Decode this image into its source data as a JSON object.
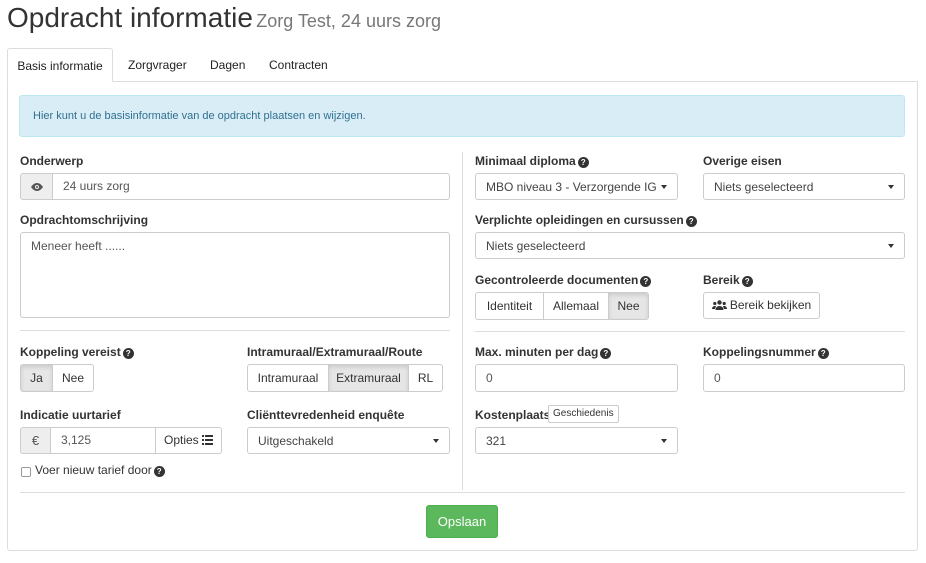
{
  "header": {
    "title": "Opdracht informatie",
    "subtitle": "Zorg Test, 24 uurs zorg"
  },
  "tabs": [
    {
      "label": "Basis informatie",
      "active": true
    },
    {
      "label": "Zorgvrager"
    },
    {
      "label": "Dagen"
    },
    {
      "label": "Contracten"
    }
  ],
  "alert": {
    "text": "Hier kunt u de basisinformatie van de opdracht plaatsen en wijzigen."
  },
  "left": {
    "onderwerp": {
      "label": "Onderwerp",
      "value": "24 uurs zorg",
      "icon": "eye-icon"
    },
    "omschrijving": {
      "label": "Opdrachtomschrijving",
      "value": "Meneer heeft ......"
    },
    "koppeling": {
      "label": "Koppeling vereist",
      "options": [
        "Ja",
        "Nee"
      ],
      "selected": "Ja"
    },
    "intramuraal": {
      "label": "Intramuraal/Extramuraal/Route",
      "options": [
        "Intramuraal",
        "Extramuraal",
        "RL"
      ],
      "selected": "Extramuraal"
    },
    "uurtarief": {
      "label": "Indicatie uurtarief",
      "currency": "€",
      "value": "3,125",
      "options_label": "Opties"
    },
    "tevredenheid": {
      "label": "Cliënttevredenheid enquête",
      "value": "Uitgeschakeld"
    },
    "nieuw_tarief": {
      "label": "Voer nieuw tarief door",
      "checked": false
    }
  },
  "right": {
    "diploma": {
      "label": "Minimaal diploma",
      "value": "MBO niveau 3 - Verzorgende IG"
    },
    "overige": {
      "label": "Overige eisen",
      "value": "Niets geselecteerd"
    },
    "opleidingen": {
      "label": "Verplichte opleidingen en cursussen",
      "value": "Niets geselecteerd"
    },
    "documenten": {
      "label": "Gecontroleerde documenten",
      "options": [
        "Identiteit",
        "Allemaal",
        "Nee"
      ],
      "selected": "Nee"
    },
    "bereik": {
      "label": "Bereik",
      "button": "Bereik bekijken",
      "icon": "users-icon"
    },
    "minuten": {
      "label": "Max. minuten per dag",
      "value": "0"
    },
    "koppelingsnummer": {
      "label": "Koppelingsnummer",
      "value": "0"
    },
    "kostenplaats": {
      "label": "Kostenplaats",
      "history_button": "Geschiedenis",
      "value": "321"
    }
  },
  "footer": {
    "save_label": "Opslaan"
  },
  "colors": {
    "primary_save": "#5cb85c",
    "alert_bg": "#d9edf7",
    "alert_text": "#31708f"
  }
}
